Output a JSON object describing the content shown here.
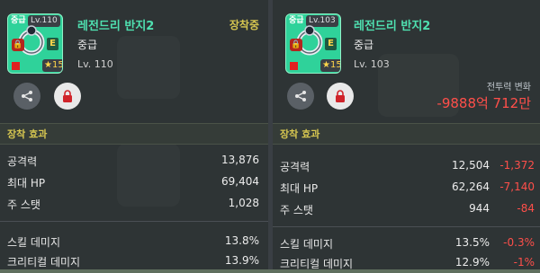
{
  "left_panel": {
    "name": "레전드리 반지2",
    "grade_tag": "중급",
    "level_tag": "Lv.110",
    "grade": "중급",
    "level": "Lv. 110",
    "equipped": "장착중",
    "star_level": "15",
    "e_badge": "E",
    "section_title": "장착 효과",
    "stats": [
      {
        "label": "공격력",
        "value": "13,876"
      },
      {
        "label": "최대 HP",
        "value": "69,404"
      },
      {
        "label": "주 스탯",
        "value": "1,028"
      },
      {
        "label": "스킬 데미지",
        "value": "13.8%"
      },
      {
        "label": "크리티컬 데미지",
        "value": "13.9%"
      }
    ]
  },
  "right_panel": {
    "name": "레전드리 반지2",
    "grade_tag": "중급",
    "level_tag": "Lv.103",
    "grade": "중급",
    "level": "Lv. 103",
    "combat_label": "전투력 변화",
    "combat_change": "-9888억 712만",
    "star_level": "15",
    "e_badge": "E",
    "section_title": "장착 효과",
    "stats": [
      {
        "label": "공격력",
        "value": "12,504",
        "diff": "-1,372"
      },
      {
        "label": "최대 HP",
        "value": "62,264",
        "diff": "-7,140"
      },
      {
        "label": "주 스탯",
        "value": "944",
        "diff": "-84"
      },
      {
        "label": "스킬 데미지",
        "value": "13.5%",
        "diff": "-0.3%"
      },
      {
        "label": "크리티컬 데미지",
        "value": "12.9%",
        "diff": "-1%"
      }
    ]
  },
  "colors": {
    "accent_green": "#4fe0b0",
    "label_yellow": "#d6c650",
    "negative_red": "#ff4f4a",
    "icon_bg": "#2fd29a"
  },
  "icons": {
    "share": "share-icon",
    "lock": "lock-icon",
    "ring": "ring-icon",
    "star": "star-icon"
  }
}
